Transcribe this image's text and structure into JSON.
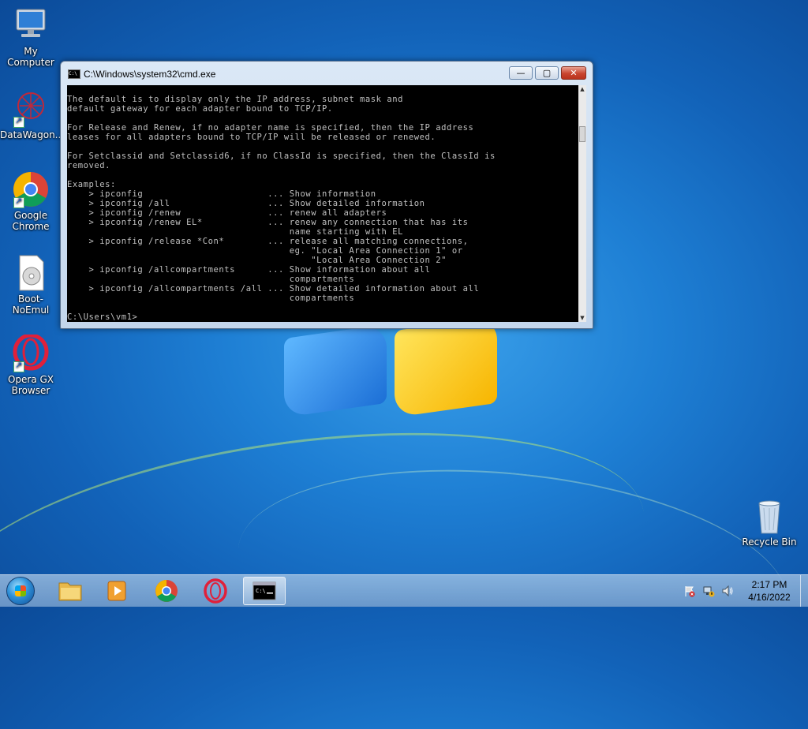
{
  "desktop": {
    "icons": [
      {
        "label": "My Computer",
        "icon": "computer-icon"
      },
      {
        "label": "DataWagon...",
        "icon": "datawagon-icon"
      },
      {
        "label": "Google Chrome",
        "icon": "chrome-icon"
      },
      {
        "label": "Boot-NoEmul",
        "icon": "disc-image-icon"
      },
      {
        "label": "Opera GX Browser",
        "icon": "opera-gx-icon"
      },
      {
        "label": "Recycle Bin",
        "icon": "recycle-bin-icon"
      }
    ]
  },
  "cmd": {
    "title": "C:\\Windows\\system32\\cmd.exe",
    "buttons": {
      "minimize": "—",
      "maximize": "▢",
      "close": "✕"
    },
    "lines": [
      "The default is to display only the IP address, subnet mask and",
      "default gateway for each adapter bound to TCP/IP.",
      "",
      "For Release and Renew, if no adapter name is specified, then the IP address",
      "leases for all adapters bound to TCP/IP will be released or renewed.",
      "",
      "For Setclassid and Setclassid6, if no ClassId is specified, then the ClassId is",
      "removed.",
      "",
      "Examples:",
      "    > ipconfig                       ... Show information",
      "    > ipconfig /all                  ... Show detailed information",
      "    > ipconfig /renew                ... renew all adapters",
      "    > ipconfig /renew EL*            ... renew any connection that has its",
      "                                         name starting with EL",
      "    > ipconfig /release *Con*        ... release all matching connections,",
      "                                         eg. \"Local Area Connection 1\" or",
      "                                             \"Local Area Connection 2\"",
      "    > ipconfig /allcompartments      ... Show information about all",
      "                                         compartments",
      "    > ipconfig /allcompartments /all ... Show detailed information about all",
      "                                         compartments",
      "",
      "C:\\Users\\vm1>"
    ]
  },
  "taskbar": {
    "items": [
      {
        "name": "file-explorer",
        "icon": "folder-icon"
      },
      {
        "name": "media-player",
        "icon": "media-player-icon"
      },
      {
        "name": "chrome",
        "icon": "chrome-icon"
      },
      {
        "name": "opera",
        "icon": "opera-gx-icon"
      },
      {
        "name": "cmd",
        "icon": "cmd-icon"
      }
    ],
    "cmd_icon_text": "C:\\",
    "clock": {
      "time": "2:17 PM",
      "date": "4/16/2022"
    }
  }
}
